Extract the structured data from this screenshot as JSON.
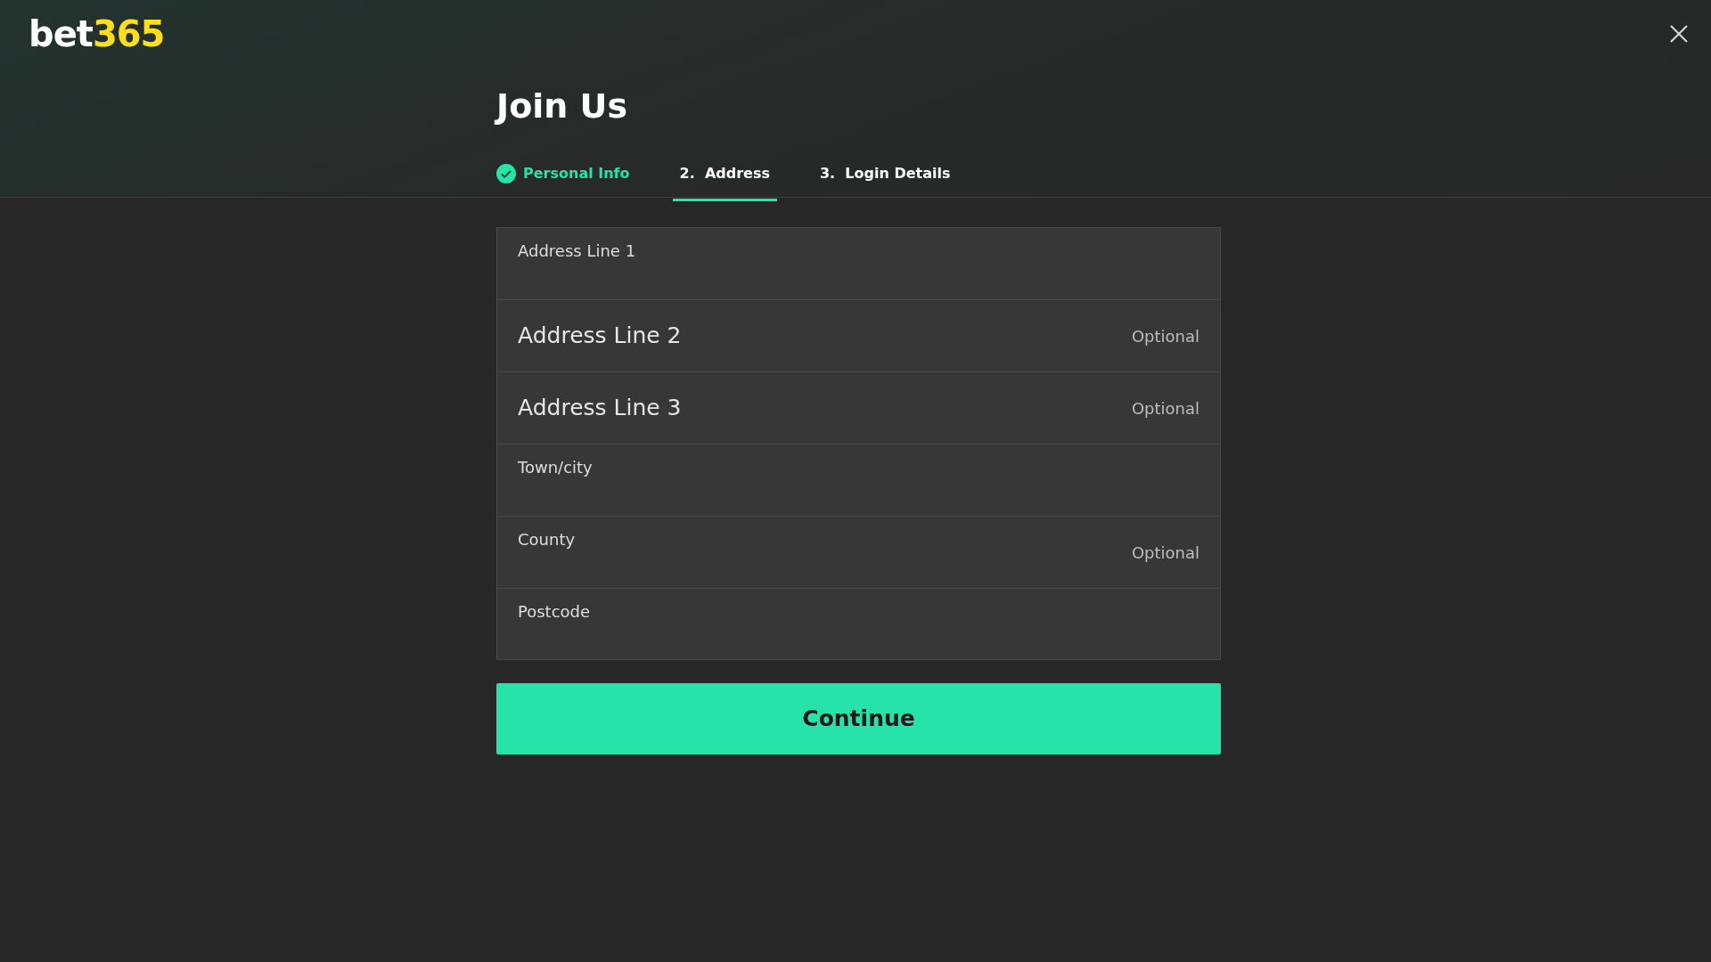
{
  "logo": {
    "part_1": "bet",
    "part_2": "365"
  },
  "title": "Join Us",
  "steps": [
    {
      "label": "Personal Info",
      "completed": true,
      "selected": false
    },
    {
      "label": "Address",
      "number": "2.",
      "completed": false,
      "selected": true
    },
    {
      "label": "Login Details",
      "number": "3.",
      "completed": false,
      "selected": false
    }
  ],
  "fields": [
    {
      "label": "Address Line 1",
      "floated": true
    },
    {
      "label": "Address Line 2",
      "floated": false,
      "hint": "Optional"
    },
    {
      "label": "Address Line 3",
      "floated": false,
      "hint": "Optional"
    },
    {
      "label": "Town/city",
      "floated": true
    },
    {
      "label": "County",
      "floated": true,
      "hint": "Optional"
    },
    {
      "label": "Postcode",
      "floated": true
    }
  ],
  "continue_button": "Continue"
}
